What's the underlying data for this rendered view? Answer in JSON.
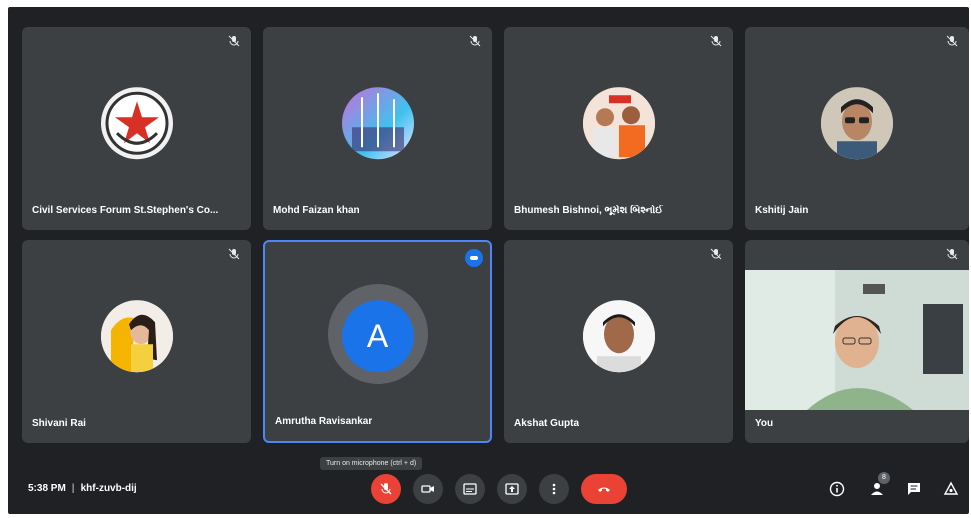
{
  "participants": [
    {
      "name": "Civil Services Forum St.Stephen's Co..."
    },
    {
      "name": "Mohd Faizan khan"
    },
    {
      "name": "Bhumesh Bishnoi, ભૂમેશ બિશ્નોઈ"
    },
    {
      "name": "Kshitij Jain"
    },
    {
      "name": "Shivani Rai"
    },
    {
      "name": "Amrutha Ravisankar",
      "initial": "A"
    },
    {
      "name": "Akshat Gupta"
    },
    {
      "name": "You"
    }
  ],
  "tooltip": "Turn on microphone (ctrl + d)",
  "bottom_bar": {
    "time": "5:38 PM",
    "meeting_code": "khf-zuvb-dij",
    "participant_count": "8"
  },
  "colors": {
    "background": "#202124",
    "tile": "#3c4043",
    "accent_blue": "#1a73e8",
    "danger_red": "#ea4335"
  }
}
